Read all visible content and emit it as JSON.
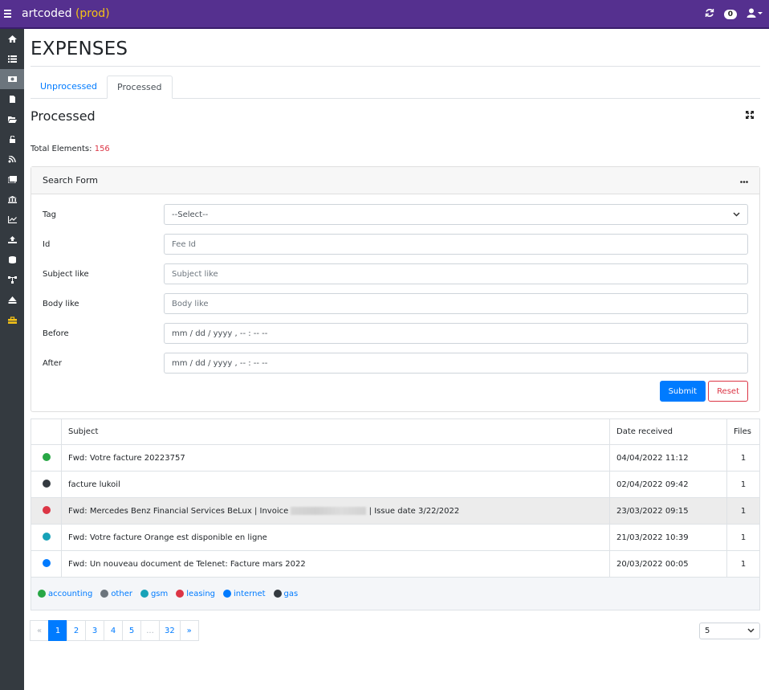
{
  "app": {
    "name": "artcoded",
    "env": "(prod)"
  },
  "topbar": {
    "notifications": "0"
  },
  "page": {
    "title": "EXPENSES"
  },
  "tabs": [
    {
      "label": "Unprocessed"
    },
    {
      "label": "Processed"
    }
  ],
  "section": {
    "title": "Processed",
    "total_label": "Total Elements:",
    "total_value": "156"
  },
  "search_form": {
    "title": "Search Form",
    "fields": [
      {
        "label": "Tag",
        "value": "--Select--"
      },
      {
        "label": "Id",
        "placeholder": "Fee Id"
      },
      {
        "label": "Subject like",
        "placeholder": "Subject like"
      },
      {
        "label": "Body like",
        "placeholder": "Body like"
      },
      {
        "label": "Before",
        "placeholder": "mm / dd / yyyy ,  -- : --   --"
      },
      {
        "label": "After",
        "placeholder": "mm / dd / yyyy ,  -- : --   --"
      }
    ],
    "submit": "Submit",
    "reset": "Reset"
  },
  "table": {
    "headers": [
      "",
      "Subject",
      "Date received",
      "Files"
    ],
    "rows": [
      {
        "color": "#28a745",
        "subject": "Fwd: Votre facture 20223757",
        "date": "04/04/2022 11:12",
        "files": "1"
      },
      {
        "color": "#343a40",
        "subject": "facture lukoil",
        "date": "02/04/2022 09:42",
        "files": "1"
      },
      {
        "color": "#dc3545",
        "subject_pre": "Fwd: Mercedes Benz Financial Services BeLux | Invoice",
        "subject_post": "| Issue date 3/22/2022",
        "date": "23/03/2022 09:15",
        "files": "1"
      },
      {
        "color": "#17a2b8",
        "subject": "Fwd: Votre facture Orange est disponible en ligne",
        "date": "21/03/2022 10:39",
        "files": "1"
      },
      {
        "color": "#007bff",
        "subject": "Fwd: Un nouveau document de Telenet: Facture mars 2022",
        "date": "20/03/2022 00:05",
        "files": "1"
      }
    ],
    "legend": [
      {
        "label": "accounting",
        "color": "#28a745"
      },
      {
        "label": "other",
        "color": "#6c757d"
      },
      {
        "label": "gsm",
        "color": "#17a2b8"
      },
      {
        "label": "leasing",
        "color": "#dc3545"
      },
      {
        "label": "internet",
        "color": "#007bff"
      },
      {
        "label": "gas",
        "color": "#343a40"
      }
    ]
  },
  "pagination": {
    "prev": "«",
    "pages": [
      "1",
      "2",
      "3",
      "4",
      "5",
      "...",
      "32"
    ],
    "next": "»",
    "page_size": "5"
  }
}
